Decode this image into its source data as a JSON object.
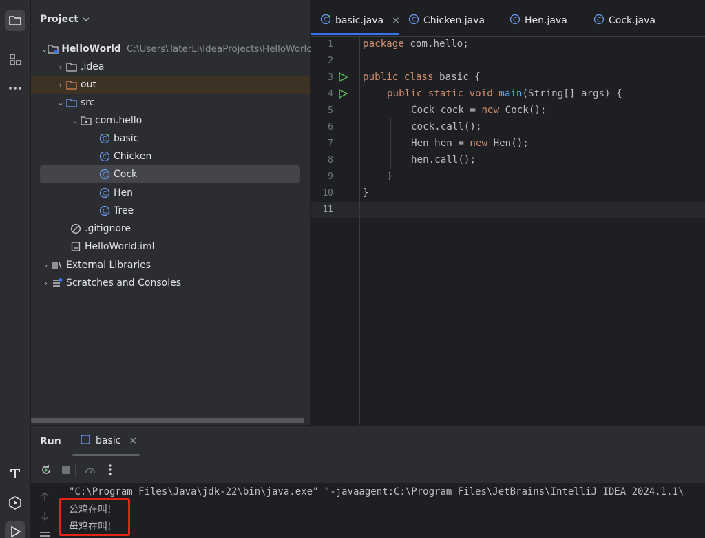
{
  "project": {
    "header": "Project",
    "tree": [
      {
        "label": "HelloWorld",
        "path": "C:\\Users\\TaterLi\\IdeaProjects\\HelloWorld"
      },
      {
        "label": ".idea"
      },
      {
        "label": "out"
      },
      {
        "label": "src"
      },
      {
        "label": "com.hello"
      },
      {
        "label": "basic"
      },
      {
        "label": "Chicken"
      },
      {
        "label": "Cock"
      },
      {
        "label": "Hen"
      },
      {
        "label": "Tree"
      },
      {
        "label": ".gitignore"
      },
      {
        "label": "HelloWorld.iml"
      },
      {
        "label": "External Libraries"
      },
      {
        "label": "Scratches and Consoles"
      }
    ]
  },
  "editor": {
    "tabs": [
      "basic.java",
      "Chicken.java",
      "Hen.java",
      "Cock.java"
    ],
    "line_numbers": [
      "1",
      "2",
      "3",
      "4",
      "5",
      "6",
      "7",
      "8",
      "9",
      "10",
      "11"
    ],
    "code": {
      "l1_kw": "package",
      "l1_rest": " com.hello;",
      "l3_kw": "public class",
      "l3_rest": " basic {",
      "l4_kw": "public static void",
      "l4_fn": "main",
      "l4_rest": "(String[] args) {",
      "l5_a": "Cock cock = ",
      "l5_kw": "new",
      "l5_b": " Cock();",
      "l6": "cock.call();",
      "l7_a": "Hen hen = ",
      "l7_kw": "new",
      "l7_b": " Hen();",
      "l8": "hen.call();",
      "l9": "}",
      "l10": "}"
    }
  },
  "run": {
    "title": "Run",
    "tab": "basic",
    "console": [
      "\"C:\\Program Files\\Java\\jdk-22\\bin\\java.exe\" \"-javaagent:C:\\Program Files\\JetBrains\\IntelliJ IDEA 2024.1.1\\",
      "公鸡在叫!",
      "母鸡在叫!"
    ]
  },
  "colors": {
    "accent": "#3574f0",
    "highlight_box": "#e3241b",
    "keyword": "#cf8e6d",
    "function": "#56a8f5"
  }
}
